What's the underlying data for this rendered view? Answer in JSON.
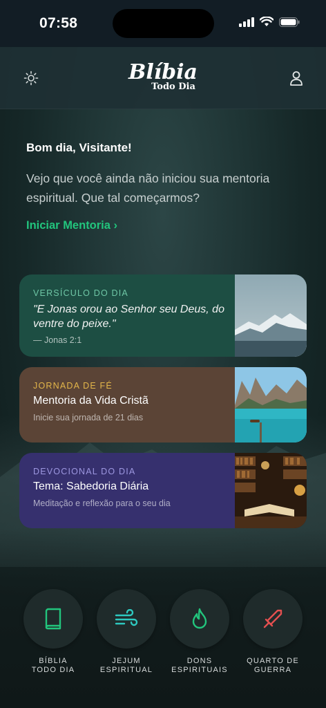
{
  "status_bar": {
    "time": "07:58"
  },
  "header": {
    "logo_main": "Blíbia",
    "logo_sub": "Todo Dia"
  },
  "greeting": {
    "title": "Bom dia, Visitante!",
    "message": "Vejo que você ainda não iniciou sua mentoria espiritual. Que tal começarmos?",
    "cta": "Iniciar Mentoria ›"
  },
  "cards": [
    {
      "eyebrow": "VERSÍCULO DO DIA",
      "quote": "\"E Jonas orou ao Senhor seu Deus, do ventre do peixe.\"",
      "reference": "— Jonas 2:1"
    },
    {
      "eyebrow": "JORNADA DE FÉ",
      "title": "Mentoria da Vida Cristã",
      "subtitle": "Inicie sua jornada de 21 dias"
    },
    {
      "eyebrow": "DEVOCIONAL DO DIA",
      "title": "Tema: Sabedoria Diária",
      "subtitle": "Meditação e reflexão para o seu dia"
    }
  ],
  "nav": [
    {
      "label": "BÍBLIA\nTODO DIA",
      "icon": "book-icon",
      "color": "#22c57d"
    },
    {
      "label": "JEJUM\nESPIRITUAL",
      "icon": "wind-icon",
      "color": "#2ec9c0"
    },
    {
      "label": "DONS\nESPIRITUAIS",
      "icon": "flame-icon",
      "color": "#22c57d"
    },
    {
      "label": "QUARTO DE\nGUERRA",
      "icon": "sword-icon",
      "color": "#e45050"
    }
  ]
}
